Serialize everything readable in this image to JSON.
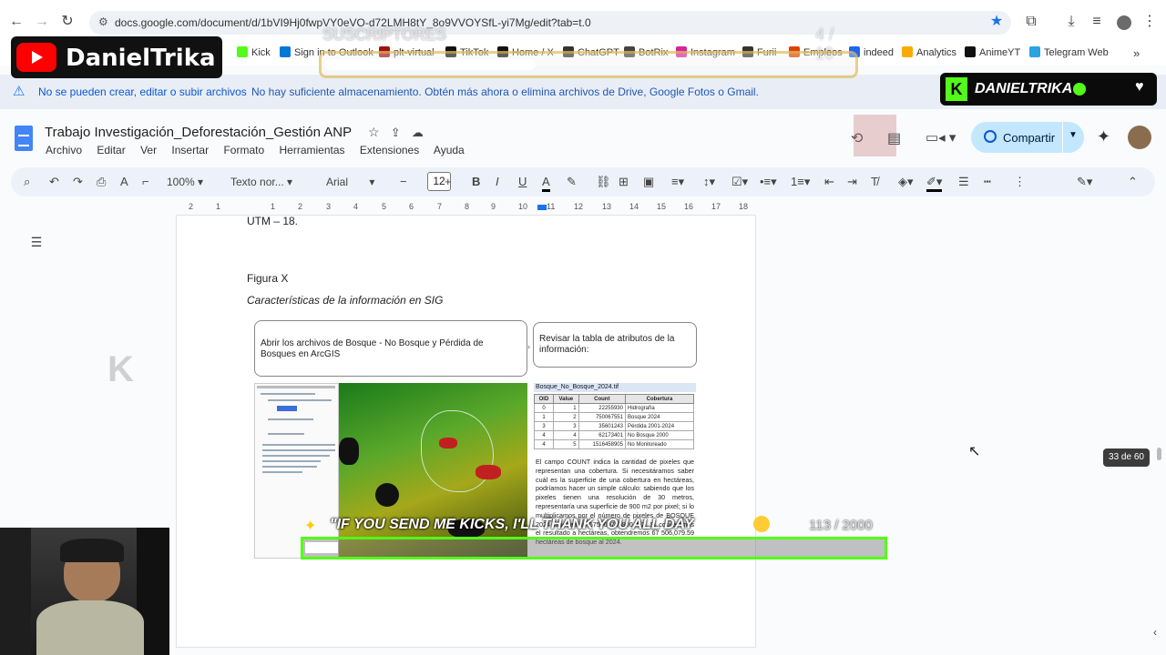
{
  "browser": {
    "url": "docs.google.com/document/d/1bVI9Hj0fwpVY0eVO-d72LMH8tY_8o9VVOYSfL-yi7Mg/edit?tab=t.0",
    "bookmarks": [
      {
        "label": "Kick",
        "color": "#53fc18"
      },
      {
        "label": "Sign in to Outlook",
        "color": "#0078d4"
      },
      {
        "label": "plt-virtual",
        "color": "#a01010"
      },
      {
        "label": "TikTok",
        "color": "#111111"
      },
      {
        "label": "Home / X",
        "color": "#111111"
      },
      {
        "label": "ChatGPT",
        "color": "#333333"
      },
      {
        "label": "BotRix",
        "color": "#444444"
      },
      {
        "label": "Instagram",
        "color": "#d6249f"
      },
      {
        "label": "Furii",
        "color": "#333333"
      },
      {
        "label": "Empleos",
        "color": "#e04000"
      },
      {
        "label": "indeed",
        "color": "#2164f3"
      },
      {
        "label": "Analytics",
        "color": "#f9ab00"
      },
      {
        "label": "AnimeYT",
        "color": "#111111"
      },
      {
        "label": "Telegram Web",
        "color": "#2aa3e0"
      }
    ]
  },
  "banner": {
    "title": "No se pueden crear, editar o subir archivos",
    "message": "No hay suficiente almacenamiento. Obtén más ahora o elimina archivos de Drive, Google Fotos o Gmail."
  },
  "doc": {
    "title": "Trabajo Investigación_Deforestación_Gestión ANP",
    "menu": [
      "Archivo",
      "Editar",
      "Ver",
      "Insertar",
      "Formato",
      "Herramientas",
      "Extensiones",
      "Ayuda"
    ],
    "share_label": "Compartir"
  },
  "toolbar": {
    "zoom": "100%",
    "style": "Texto nor...",
    "font": "Arial",
    "font_size": "12"
  },
  "ruler": [
    "2",
    "1",
    "1",
    "2",
    "3",
    "4",
    "5",
    "6",
    "7",
    "8",
    "9",
    "10",
    "11",
    "12",
    "13",
    "14",
    "15",
    "16",
    "17",
    "18"
  ],
  "content": {
    "cut_line": "UTM – 18.",
    "figure_label": "Figura X",
    "figure_caption": "Características de la información en SIG",
    "box1": "Abrir los archivos de Bosque - No Bosque y Pérdida de Bosques en ArcGIS",
    "box2": "Revisar la tabla de atributos de la información:",
    "table_title": "Bosque_No_Bosque_2024.tif",
    "table_headers": [
      "OID",
      "Value",
      "Count",
      "Cobertura"
    ],
    "table_rows": [
      [
        "0",
        "1",
        "22255930",
        "Hidrografía"
      ],
      [
        "1",
        "2",
        "750067551",
        "Bosque 2024"
      ],
      [
        "3",
        "3",
        "35601243",
        "Pérdida 2001-2024"
      ],
      [
        "4",
        "4",
        "62173401",
        "No Bosque 2000"
      ],
      [
        "4",
        "5",
        "1516458905",
        "No Monitoreado"
      ]
    ],
    "paragraph": "El campo COUNT indica la cantidad de pixeles que representan una cobertura. Si necesitáramos saber cuál es la superficie de una cobertura en hectáreas, podríamos hacer un simple cálculo: sabiendo que los pixeles tienen una resolución de 30 metros, representaría una superficie de 900 m2 por pixel; si lo multiplicamos por el número de pixeles de BOSQUE 2024 tendríamos 675060795900 m2. Si convertimos el resultado a hectáreas, obtendremos 67 506,079.59 hectáreas de bosque al 2024."
  },
  "overlays": {
    "yt_name": "DanielTrika",
    "kick_name": "DANIELTRIKA",
    "subs_label": "SUSCRIPTORES",
    "subs_count": "4 / 10",
    "subs_progress": 0.4,
    "kicks_label": "\"IF YOU SEND ME KICKS, I'LL THANK YOU ALL DAY",
    "kicks_count": "113 / 2000",
    "kicks_progress": 0.0565,
    "page_counter": "33 de 60"
  }
}
